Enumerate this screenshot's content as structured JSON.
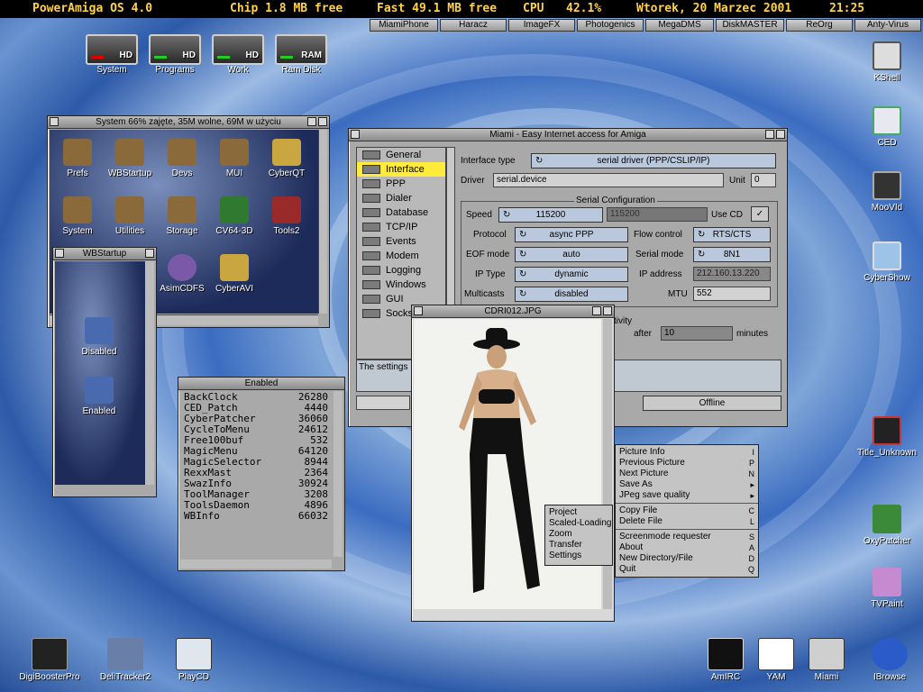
{
  "menubar": {
    "os": "PowerAmiga OS 4.0",
    "chip": "Chip 1.8 MB free",
    "fast": "Fast 49.1 MB free",
    "cpu": "CPU",
    "cpu_val": "42.1%",
    "date": "Wtorek, 20 Marzec 2001",
    "time": "21:25"
  },
  "dock": [
    "MiamiPhone",
    "Haracz",
    "ImageFX",
    "Photogenics",
    "MegaDMS",
    "DiskMASTER",
    "ReOrg",
    "Anty-Virus"
  ],
  "drives": [
    {
      "label": "System",
      "tag": "HD"
    },
    {
      "label": "Programs",
      "tag": "HD"
    },
    {
      "label": "Work",
      "tag": "HD"
    },
    {
      "label": "Ram Disk",
      "tag": "RAM"
    }
  ],
  "system_window": {
    "title": "System  66% zajęte, 35M wolne, 69M w użyciu",
    "icons": [
      "Prefs",
      "WBStartup",
      "Devs",
      "MUI",
      "CyberQT",
      "System",
      "Utilities",
      "Storage",
      "CV64-3D",
      "Tools2",
      "AsimCDFS",
      "CyberAVI"
    ]
  },
  "wbstartup_window": {
    "title": "WBStartup",
    "icons": [
      "Disabled",
      "Enabled"
    ]
  },
  "enabled_window": {
    "title": "Enabled",
    "items": [
      [
        "BackClock",
        "26280"
      ],
      [
        "CED_Patch",
        "4440"
      ],
      [
        "CyberPatcher",
        "36060"
      ],
      [
        "CycleToMenu",
        "24612"
      ],
      [
        "Free100buf",
        "532"
      ],
      [
        "MagicMenu",
        "64120"
      ],
      [
        "MagicSelector",
        "8944"
      ],
      [
        "RexxMast",
        "2364"
      ],
      [
        "SwazInfo",
        "30924"
      ],
      [
        "ToolManager",
        "3208"
      ],
      [
        "ToolsDaemon",
        "4896"
      ],
      [
        "WBInfo",
        "66032"
      ]
    ]
  },
  "miami_window": {
    "title": "Miami - Easy Internet access for Amiga",
    "nav": [
      "General",
      "Interface",
      "PPP",
      "Dialer",
      "Database",
      "TCP/IP",
      "Events",
      "Modem",
      "Logging",
      "Windows",
      "GUI",
      "Socks"
    ],
    "selected": "Interface",
    "interface_type_label": "Interface type",
    "interface_type": "serial driver (PPP/CSLIP/IP)",
    "driver_label": "Driver",
    "driver": "serial.device",
    "unit_label": "Unit",
    "unit": "0",
    "serial_config": "Serial Configuration",
    "speed_label": "Speed",
    "speed": "115200",
    "speed2": "115200",
    "use_cd": "Use CD",
    "protocol_label": "Protocol",
    "protocol": "async PPP",
    "flow_label": "Flow control",
    "flow": "RTS/CTS",
    "eof_label": "EOF mode",
    "eof": "auto",
    "serial_mode_label": "Serial mode",
    "serial_mode": "8N1",
    "iptype_label": "IP Type",
    "iptype": "dynamic",
    "ipaddr_label": "IP address",
    "ipaddr": "212.160.13.220",
    "multicasts_label": "Multicasts",
    "multicasts": "disabled",
    "mtu_label": "MTU",
    "mtu": "552",
    "activity": "tivity",
    "after": "after",
    "after_val": "10",
    "minutes": "minutes",
    "settings_text": "The settings",
    "offline": "Offline"
  },
  "image_window": {
    "title": "CDRI012.JPG"
  },
  "context_menu": [
    "Project",
    "Scaled-Loading",
    "Zoom",
    "Transfer",
    "Settings"
  ],
  "picture_menu": [
    [
      "Picture Info",
      "I"
    ],
    [
      "Previous Picture",
      "P"
    ],
    [
      "Next Picture",
      "N"
    ],
    [
      "Save As",
      "▸"
    ],
    [
      "JPeg save quality",
      "▸"
    ],
    [
      "-",
      ""
    ],
    [
      "Copy File",
      "C"
    ],
    [
      "Delete File",
      "L"
    ],
    [
      "-",
      ""
    ],
    [
      "Screenmode requester",
      "S"
    ],
    [
      "About",
      "A"
    ],
    [
      "New Directory/File",
      "D"
    ],
    [
      "Quit",
      "Q"
    ]
  ],
  "right_icons": [
    "KShell",
    "CED",
    "MooVId",
    "CyberShow",
    "Title_Unknown",
    "OxyPatcher",
    "TVPaint"
  ],
  "bottom_left_icons": [
    "DigiBoosterPro",
    "DeliTracker2",
    "PlayCD"
  ],
  "bottom_right_icons": [
    "AmIRC",
    "YAM",
    "Miami",
    "IBrowse"
  ],
  "colors": {
    "menubar_bg": "#000000",
    "menubar_text": "#ffd24a",
    "selection": "#ffeb3b",
    "window": "#a9a9a9"
  }
}
